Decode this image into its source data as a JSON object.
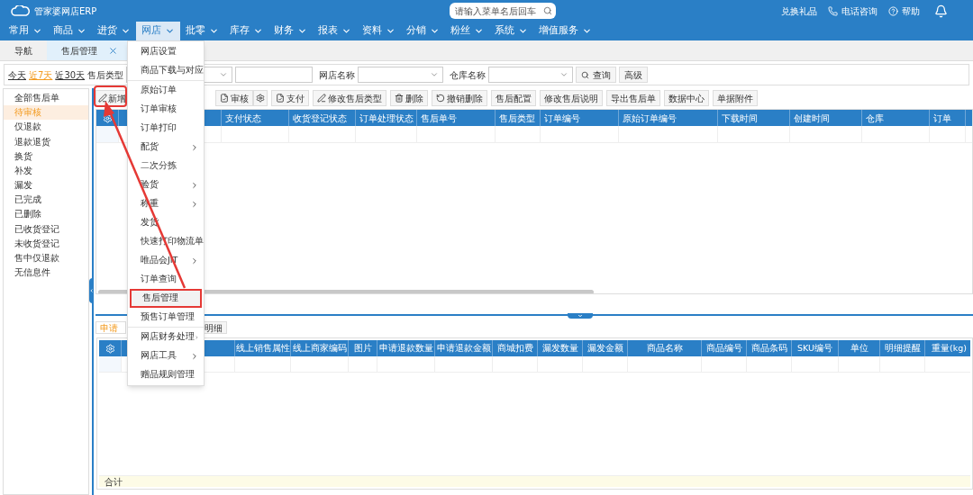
{
  "app": {
    "logo": "管家婆网店ERP",
    "search": {
      "placeholder": "请输入菜单名后回车"
    },
    "links": [
      {
        "kind": "gift",
        "label": "兑换礼品"
      },
      {
        "kind": "phone",
        "label": "电话咨询"
      },
      {
        "kind": "help",
        "label": "帮助"
      }
    ]
  },
  "menu": [
    {
      "label": "常用",
      "selected": false
    },
    {
      "label": "商品",
      "selected": false
    },
    {
      "label": "进货",
      "selected": false
    },
    {
      "label": "网店",
      "selected": true
    },
    {
      "label": "批零",
      "selected": false
    },
    {
      "label": "库存",
      "selected": false
    },
    {
      "label": "财务",
      "selected": false
    },
    {
      "label": "报表",
      "selected": false
    },
    {
      "label": "资料",
      "selected": false
    },
    {
      "label": "分销",
      "selected": false
    },
    {
      "label": "粉丝",
      "selected": false
    },
    {
      "label": "系统",
      "selected": false
    },
    {
      "label": "增值服务",
      "selected": false
    }
  ],
  "tabs": [
    {
      "label": "导航",
      "selected": false,
      "closable": false
    },
    {
      "label": "售后管理",
      "selected": true,
      "closable": true
    }
  ],
  "filter": {
    "ranges": [
      {
        "label": "今天",
        "selected": false
      },
      {
        "label": "近7天",
        "selected": true
      },
      {
        "label": "近30天",
        "selected": false
      }
    ],
    "type_label": "售后类型",
    "shop_label": "网店名称",
    "warehouse_label": "仓库名称",
    "buttons": [
      "查询",
      "高级"
    ]
  },
  "sidebar": [
    {
      "label": "全部售后单",
      "selected": false
    },
    {
      "label": "待审核",
      "selected": true
    },
    {
      "label": "仅退款",
      "selected": false
    },
    {
      "label": "退款退货",
      "selected": false
    },
    {
      "label": "换货",
      "selected": false
    },
    {
      "label": "补发",
      "selected": false
    },
    {
      "label": "漏发",
      "selected": false
    },
    {
      "label": "已完成",
      "selected": false
    },
    {
      "label": "已删除",
      "selected": false
    },
    {
      "label": "已收货登记",
      "selected": false
    },
    {
      "label": "未收货登记",
      "selected": false
    },
    {
      "label": "售中仅退款",
      "selected": false
    },
    {
      "label": "无信息件",
      "selected": false
    }
  ],
  "toolbar": [
    {
      "kind": "edit",
      "label": "新增"
    },
    {
      "kind": "gap"
    },
    {
      "kind": "doc",
      "label": "审核"
    },
    {
      "kind": "gear"
    },
    {
      "kind": "doc",
      "label": "支付"
    },
    {
      "kind": "edit",
      "label": "修改售后类型"
    },
    {
      "kind": "trash",
      "label": "删除"
    },
    {
      "kind": "undo",
      "label": "撤销删除"
    },
    {
      "kind": "plain",
      "label": "售后配置"
    },
    {
      "kind": "plain",
      "label": "修改售后说明"
    },
    {
      "kind": "plain",
      "label": "导出售后单"
    },
    {
      "kind": "plain",
      "label": "数据中心"
    },
    {
      "kind": "plain",
      "label": "单据附件"
    }
  ],
  "upper_table": {
    "columns": [
      "支付状态",
      "收货登记状态",
      "订单处理状态",
      "售后单号",
      "售后类型",
      "订单编号",
      "原始订单编号",
      "下载时间",
      "创建时间",
      "仓库",
      "订单"
    ]
  },
  "lower_tabs": [
    {
      "label": "申请",
      "selected": true
    },
    {
      "label": "明细",
      "selected": false
    }
  ],
  "lower_table": {
    "columns": [
      "线上销售属性",
      "线上商家编码",
      "图片",
      "申请退款数量",
      "申请退款金额",
      "商城扣费",
      "漏发数量",
      "漏发金额",
      "商品名称",
      "商品编号",
      "商品条码",
      "SKU编号",
      "单位",
      "明细提醒",
      "重量(kg)"
    ],
    "footer": "合计"
  },
  "dropdown": {
    "groups": [
      [
        {
          "label": "网店设置",
          "submenu": false,
          "selected": false
        },
        {
          "label": "商品下载与对应",
          "submenu": false,
          "selected": false
        }
      ],
      [
        {
          "label": "原始订单",
          "submenu": false,
          "selected": false
        },
        {
          "label": "订单审核",
          "submenu": false,
          "selected": false
        },
        {
          "label": "订单打印",
          "submenu": false,
          "selected": false
        },
        {
          "label": "配货",
          "submenu": true,
          "selected": false
        },
        {
          "label": "二次分拣",
          "submenu": false,
          "selected": false
        },
        {
          "label": "验货",
          "submenu": true,
          "selected": false
        },
        {
          "label": "称重",
          "submenu": true,
          "selected": false
        },
        {
          "label": "发货",
          "submenu": false,
          "selected": false
        },
        {
          "label": "快速打印物流单",
          "submenu": false,
          "selected": false
        },
        {
          "label": "唯品会JIT",
          "submenu": true,
          "selected": false
        },
        {
          "label": "订单查询",
          "submenu": false,
          "selected": false
        },
        {
          "label": "售后管理",
          "submenu": false,
          "selected": true
        },
        {
          "label": "预售订单管理",
          "submenu": false,
          "selected": false
        }
      ],
      [
        {
          "label": "网店财务处理",
          "submenu": true,
          "selected": false
        },
        {
          "label": "网店工具",
          "submenu": true,
          "selected": false
        },
        {
          "label": "赠品规则管理",
          "submenu": false,
          "selected": false
        }
      ]
    ]
  }
}
